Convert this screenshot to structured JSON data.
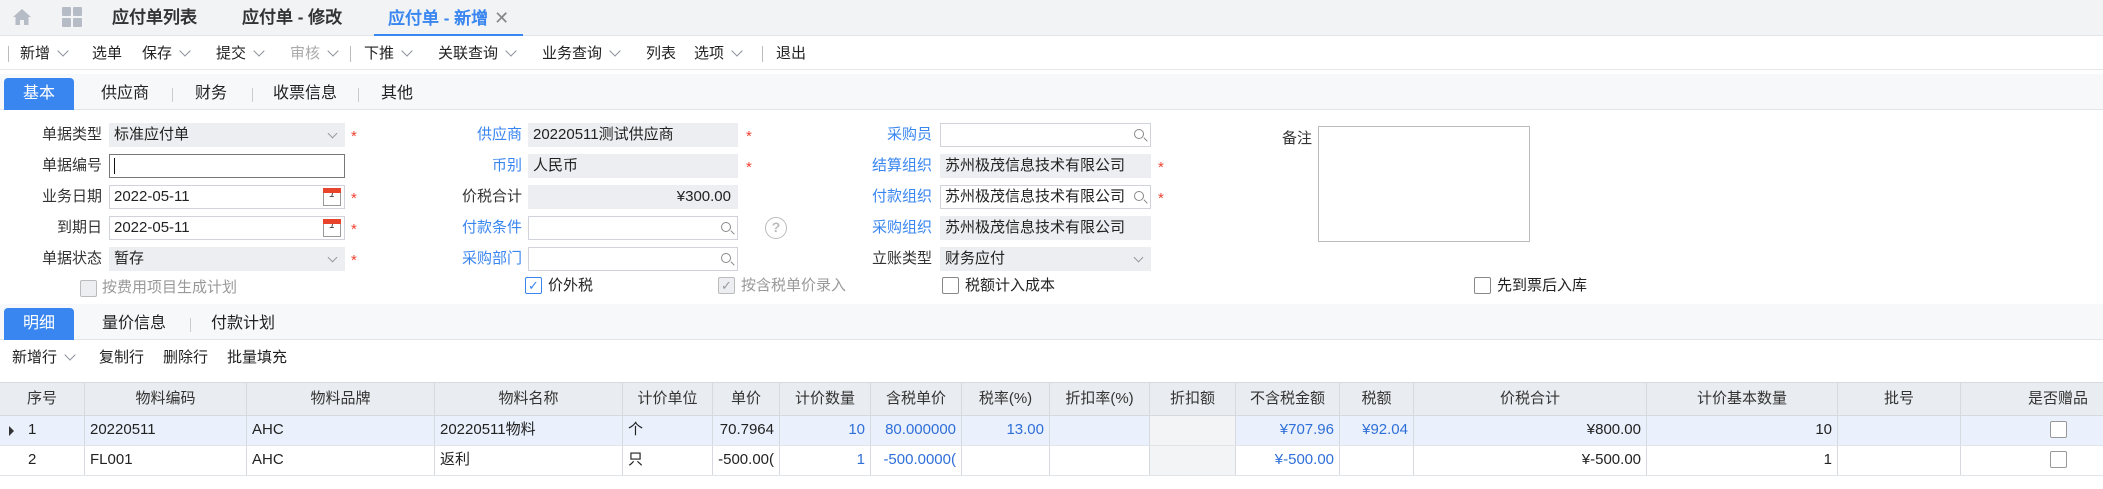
{
  "top_tabs": [
    {
      "label": "应付单列表"
    },
    {
      "label": "应付单 - 修改"
    },
    {
      "label": "应付单 - 新增",
      "active": true
    }
  ],
  "toolbar": {
    "items": [
      {
        "label": "新增",
        "dropdown": true
      },
      {
        "label": "选单",
        "dropdown": false
      },
      {
        "label": "保存",
        "dropdown": true
      },
      {
        "label": "提交",
        "dropdown": true
      },
      {
        "label": "审核",
        "dropdown": true,
        "disabled": true
      },
      {
        "label": "下推",
        "dropdown": true
      },
      {
        "label": "关联查询",
        "dropdown": true
      },
      {
        "label": "业务查询",
        "dropdown": true
      },
      {
        "label": "列表",
        "dropdown": false
      },
      {
        "label": "选项",
        "dropdown": true
      },
      {
        "label": "退出",
        "dropdown": false
      }
    ]
  },
  "section_tabs": [
    "基本",
    "供应商",
    "财务",
    "收票信息",
    "其他"
  ],
  "form": {
    "bill_type": {
      "label": "单据类型",
      "value": "标准应付单"
    },
    "bill_no": {
      "label": "单据编号",
      "value": ""
    },
    "biz_date": {
      "label": "业务日期",
      "value": "2022-05-11"
    },
    "due_date": {
      "label": "到期日",
      "value": "2022-05-11"
    },
    "bill_status": {
      "label": "单据状态",
      "value": "暂存"
    },
    "supplier": {
      "label": "供应商",
      "value": "20220511测试供应商"
    },
    "currency": {
      "label": "币别",
      "value": "人民币"
    },
    "total_tax": {
      "label": "价税合计",
      "value": "¥300.00"
    },
    "pay_terms": {
      "label": "付款条件",
      "value": ""
    },
    "purchase_dept": {
      "label": "采购部门",
      "value": ""
    },
    "purchaser": {
      "label": "采购员",
      "value": ""
    },
    "settle_org": {
      "label": "结算组织",
      "value": "苏州极茂信息技术有限公司"
    },
    "pay_org": {
      "label": "付款组织",
      "value": "苏州极茂信息技术有限公司"
    },
    "purchase_org": {
      "label": "采购组织",
      "value": "苏州极茂信息技术有限公司"
    },
    "account_type": {
      "label": "立账类型",
      "value": "财务应付"
    },
    "remark": {
      "label": "备注",
      "value": ""
    },
    "checkboxes": {
      "gen_plan": {
        "label": "按费用项目生成计划",
        "checked": false,
        "disabled": true
      },
      "price_excl_tax": {
        "label": "价外税",
        "checked": true,
        "disabled": false
      },
      "tax_price_entry": {
        "label": "按含税单价录入",
        "checked": true,
        "disabled": true
      },
      "tax_to_cost": {
        "label": "税额计入成本",
        "checked": false,
        "disabled": false
      },
      "invoice_first": {
        "label": "先到票后入库",
        "checked": false,
        "disabled": false
      }
    },
    "required_mark": "*",
    "help_mark": "?"
  },
  "detail_tabs": [
    "明细",
    "量价信息",
    "付款计划"
  ],
  "detail_toolbar": {
    "items": [
      {
        "label": "新增行",
        "dropdown": true
      },
      {
        "label": "复制行"
      },
      {
        "label": "删除行"
      },
      {
        "label": "批量填充"
      }
    ]
  },
  "table": {
    "columns": [
      "序号",
      "物料编码",
      "物料品牌",
      "物料名称",
      "计价单位",
      "单价",
      "计价数量",
      "含税单价",
      "税率(%)",
      "折扣率(%)",
      "折扣额",
      "不含税金额",
      "税额",
      "价税合计",
      "计价基本数量",
      "批号",
      "是否赠品"
    ],
    "rows": [
      [
        "1",
        "20220511",
        "AHC",
        "20220511物料",
        "个",
        "70.7964",
        "10",
        "80.000000",
        "13.00",
        "",
        "",
        "¥707.96",
        "¥92.04",
        "¥800.00",
        "10",
        "",
        ""
      ],
      [
        "2",
        "FL001",
        "AHC",
        "返利",
        "只",
        "-500.00(",
        "1",
        "-500.0000(",
        "",
        "",
        "",
        "¥-500.00",
        "",
        "¥-500.00",
        "1",
        "",
        ""
      ]
    ]
  },
  "colors": {
    "accent": "#3a86f0",
    "required": "#e43"
  }
}
